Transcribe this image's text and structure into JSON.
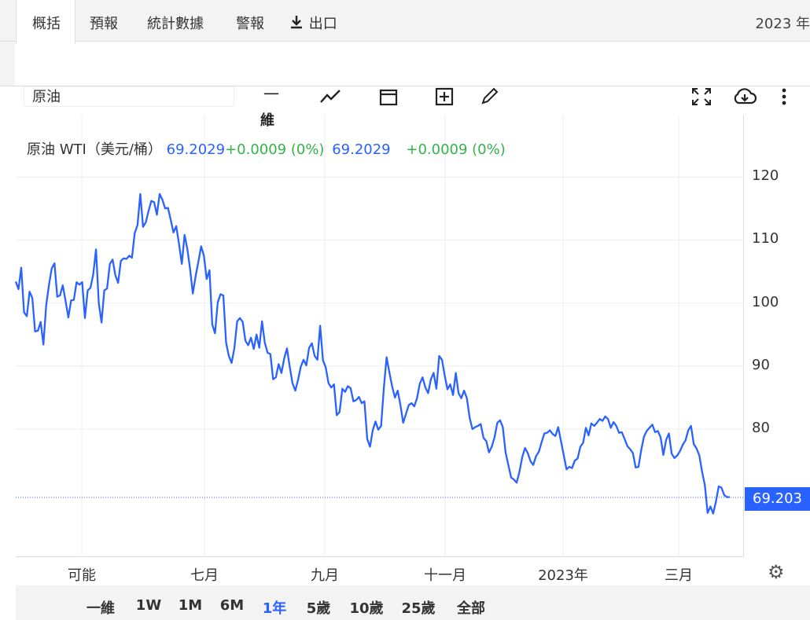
{
  "header": {
    "title": "原油",
    "year": "2023 年"
  },
  "tabs": [
    {
      "label": "概括",
      "active": true
    },
    {
      "label": "預報"
    },
    {
      "label": "統計數據"
    },
    {
      "label": "警報"
    },
    {
      "label": "出口"
    }
  ],
  "toolbar": {
    "symbol": "原油",
    "interval_label": "一",
    "interval_sub": "維"
  },
  "legend": {
    "name": "原油 WTI（美元/桶）",
    "value1": "69.2029",
    "change1": "+0.0009 (0%)",
    "value2": "69.2029",
    "change2": "+0.0009 (0%)"
  },
  "price_label": "69.203",
  "range_buttons": [
    {
      "label": "一維"
    },
    {
      "label": "1W"
    },
    {
      "label": "1M"
    },
    {
      "label": "6M"
    },
    {
      "label": "1年",
      "active": true
    },
    {
      "label": "5歲"
    },
    {
      "label": "10歲"
    },
    {
      "label": "25歲"
    },
    {
      "label": "全部"
    }
  ],
  "colors": {
    "line": "#2962ff",
    "up": "#33b34a",
    "grid": "#eeeeee"
  },
  "chart_data": {
    "type": "line",
    "title": "原油 WTI（美元/桶）",
    "x_ticks": [
      "可能",
      "七月",
      "九月",
      "十一月",
      "2023年",
      "三月"
    ],
    "y_ticks": [
      120,
      110,
      100,
      90,
      80
    ],
    "ylim": [
      60,
      130
    ],
    "last_value": 69.203,
    "series": [
      {
        "name": "原油 WTI",
        "values": [
          103.4,
          102.2,
          105.6,
          98.5,
          97.9,
          101.8,
          100.8,
          95.5,
          95.6,
          97.0,
          93.4,
          99.6,
          102.8,
          105.5,
          106.3,
          101.0,
          101.2,
          102.8,
          100.4,
          97.7,
          100.4,
          100.5,
          103.3,
          102.9,
          103.3,
          97.6,
          102.0,
          102.4,
          104.5,
          108.5,
          100.0,
          96.9,
          102.0,
          102.3,
          106.2,
          106.9,
          104.4,
          103.2,
          106.7,
          107.1,
          107.0,
          107.5,
          107.2,
          111.1,
          112.4,
          117.3,
          112.1,
          112.8,
          114.6,
          116.2,
          116.0,
          114.0,
          117.3,
          116.4,
          115.0,
          115.1,
          113.2,
          111.2,
          112.2,
          109.4,
          106.2,
          110.8,
          108.6,
          105.4,
          101.5,
          104.3,
          106.6,
          109.0,
          107.5,
          103.8,
          105.2,
          96.6,
          95.2,
          100.1,
          101.4,
          101.2,
          93.7,
          91.6,
          90.5,
          92.8,
          97.1,
          97.6,
          97.0,
          94.0,
          93.3,
          94.5,
          92.7,
          95.0,
          92.9,
          97.1,
          93.7,
          92.1,
          91.9,
          87.9,
          88.2,
          90.3,
          88.9,
          91.2,
          92.8,
          89.9,
          87.3,
          86.1,
          87.8,
          89.9,
          91.0,
          90.1,
          92.9,
          93.6,
          91.6,
          91.0,
          96.4,
          90.9,
          89.8,
          87.3,
          86.6,
          87.1,
          82.2,
          82.7,
          86.4,
          85.9,
          86.8,
          86.5,
          84.4,
          84.6,
          85.1,
          84.1,
          84.4,
          78.4,
          77.2,
          79.8,
          81.2,
          79.9,
          80.5,
          86.5,
          91.4,
          89.0,
          86.8,
          85.0,
          86.1,
          83.8,
          81.0,
          82.4,
          83.8,
          84.1,
          83.6,
          84.9,
          87.2,
          88.2,
          86.6,
          85.7,
          87.9,
          88.9,
          86.4,
          91.6,
          91.0,
          88.5,
          86.3,
          87.1,
          85.4,
          88.9,
          85.7,
          84.9,
          86.1,
          84.9,
          81.8,
          80.0,
          80.3,
          80.5,
          80.8,
          78.6,
          78.1,
          76.3,
          77.2,
          78.7,
          81.0,
          81.4,
          80.3,
          76.3,
          74.3,
          72.3,
          72.0,
          71.5,
          73.2,
          75.5,
          77.0,
          76.2,
          74.9,
          74.3,
          75.7,
          76.4,
          77.9,
          79.3,
          79.4,
          79.8,
          79.2,
          78.9,
          80.3,
          78.1,
          75.9,
          73.6,
          74.0,
          73.8,
          75.0,
          75.3,
          77.2,
          77.8,
          80.2,
          79.0,
          80.9,
          80.5,
          81.0,
          81.6,
          81.3,
          82.0,
          81.6,
          80.2,
          81.1,
          80.5,
          79.4,
          79.5,
          78.4,
          77.3,
          76.8,
          76.2,
          73.9,
          74.0,
          76.7,
          78.8,
          79.7,
          80.2,
          80.7,
          79.5,
          79.7,
          78.7,
          75.9,
          78.3,
          79.3,
          76.1,
          75.4,
          75.8,
          76.5,
          77.5,
          78.2,
          79.8,
          80.5,
          77.6,
          76.9,
          75.8,
          73.2,
          71.1,
          66.7,
          67.7,
          66.6,
          68.5,
          70.9,
          70.7,
          69.5,
          69.2,
          69.2
        ]
      }
    ]
  }
}
